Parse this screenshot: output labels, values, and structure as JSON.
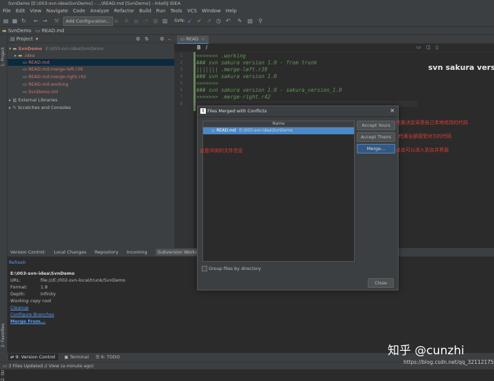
{
  "window": {
    "title": "SvnDemo [E:\\003-svn-idea\\SvnDemo] - ...\\READ.md [SvnDemo] - IntelliJ IDEA"
  },
  "menu": [
    "File",
    "Edit",
    "View",
    "Navigate",
    "Code",
    "Analyze",
    "Refactor",
    "Build",
    "Run",
    "Tools",
    "VCS",
    "Window",
    "Help"
  ],
  "toolbar": {
    "add_config": "Add Configuration...",
    "svn_label": "SVN:"
  },
  "navbar": {
    "project": "SvnDemo",
    "file": "READ.md"
  },
  "project_panel": {
    "header": "Project",
    "tree": [
      {
        "label": "SvnDemo",
        "path": "E:\\003-svn-idea\\SvnDemo",
        "color": "#d5756c"
      },
      {
        "label": ".idea",
        "color": "#d5756c"
      },
      {
        "label": "READ.md",
        "color": "#d5756c"
      },
      {
        "label": "READ.md.merge-left.r39",
        "color": "#d5756c"
      },
      {
        "label": "READ.md.merge-right.r42",
        "color": "#d5756c"
      },
      {
        "label": "READ.md.working",
        "color": "#d5756c"
      },
      {
        "label": "SvnDemo.iml",
        "color": "#d5756c"
      },
      {
        "label": "External Libraries",
        "color": "#bbbbbb"
      },
      {
        "label": "Scratches and Consoles",
        "color": "#bbbbbb"
      }
    ]
  },
  "editor": {
    "tab": "READ",
    "toolbar": [
      "B",
      "I"
    ],
    "lines": [
      {
        "n": "1",
        "text": "<<<<<<< .working"
      },
      {
        "n": "2",
        "text": "### svn sakura version 1.0 - from trunk"
      },
      {
        "n": "3",
        "text": "||||||| .merge-left.r39"
      },
      {
        "n": "4",
        "text": "### svn sakura version 1.0"
      },
      {
        "n": "5",
        "text": "======="
      },
      {
        "n": "6",
        "text": "### svn sakura version 1.0 - sakura_version_1.0"
      },
      {
        "n": "7",
        "text": ">>>>>>> .merge-right.r42"
      },
      {
        "n": "8",
        "text": ""
      }
    ],
    "preview_heading": "svn sakura versi"
  },
  "bottom": {
    "tabs": [
      "Version Control:",
      "Local Changes",
      "Repository",
      "Incoming",
      "Subversion Working Co"
    ],
    "refresh": "Refresh",
    "path": "E:\\003-svn-idea\\SvnDemo",
    "url_label": "URL:",
    "url_value": "file:///E:/002-svn-local/trunk/SvnDemo",
    "format_label": "Format:",
    "format_value": "1.8",
    "depth_label": "Depth:",
    "depth_value": "infinity",
    "working_copy": "Working copy root",
    "cleanup": "Cleanup",
    "configure": "Configure Branches",
    "merge_from": "Merge From..."
  },
  "side_tabs": {
    "project": "1: Project",
    "favorites": "2: Favorites",
    "structure": "Z: Structure"
  },
  "tool_strip": {
    "vc": "9: Version Control",
    "terminal": "Terminal",
    "todo": "6: TODO"
  },
  "status": "3 Files Updated // View (a minute ago)",
  "dialog": {
    "title": "Files Merged with Conflicts",
    "column": "Name",
    "item_name": "READ.md",
    "item_path": "E:\\003-svn-idea\\SvnDemo",
    "accept_yours": "Accept Yours",
    "accept_theirs": "Accept Theirs",
    "merge": "Merge...",
    "group": "Group files by directory",
    "close": "Close"
  },
  "annotations": {
    "left": "这是冲突的文件信息",
    "yours": "代表决定采用自己本地修改的代码",
    "theirs": "代表全部接受对方的代码",
    "merge": "点击可以进入到合并界面"
  },
  "watermark": {
    "brand": "知乎 @cunzhi",
    "url": "https://blog.csdn.net/qq_32112175"
  },
  "colors": {
    "accent": "#4a88c7",
    "annotation": "#e03c31",
    "code": "#629755"
  }
}
